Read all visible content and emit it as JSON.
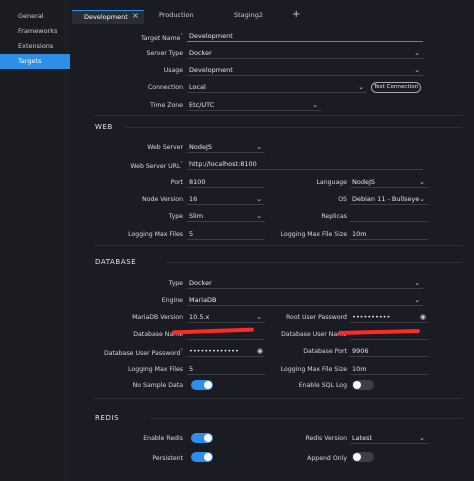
{
  "sidebar": {
    "items": [
      {
        "label": "General",
        "active": false
      },
      {
        "label": "Frameworks",
        "active": false
      },
      {
        "label": "Extensions",
        "active": false
      },
      {
        "label": "Targets",
        "active": true
      }
    ]
  },
  "tabs": [
    {
      "label": "Development",
      "active": true
    },
    {
      "label": "Production",
      "active": false
    },
    {
      "label": "Staging2",
      "active": false
    }
  ],
  "tab_close_glyph": "×",
  "tab_add_glyph": "+",
  "target": {
    "name_label": "Target Name",
    "name_value": "Development",
    "server_type_label": "Server Type",
    "server_type_value": "Docker",
    "usage_label": "Usage",
    "usage_value": "Development",
    "connection_label": "Connection",
    "connection_value": "Local",
    "test_connection_label": "Test Connection",
    "timezone_label": "Time Zone",
    "timezone_value": "Etc/UTC"
  },
  "web": {
    "heading": "WEB",
    "server_label": "Web Server",
    "server_value": "NodeJS",
    "url_label": "Web Server URL",
    "url_value": "http://localhost:8100",
    "port_label": "Port",
    "port_value": "8100",
    "language_label": "Language",
    "language_value": "NodeJS",
    "node_version_label": "Node Version",
    "node_version_value": "16",
    "os_label": "OS",
    "os_value": "Debian 11 - Bullseye",
    "type_label": "Type",
    "type_value": "Slim",
    "replicas_label": "Replicas",
    "log_max_files_label": "Logging Max Files",
    "log_max_files_value": "5",
    "log_max_size_label": "Logging Max File Size",
    "log_max_size_value": "10m"
  },
  "database": {
    "heading": "DATABASE",
    "type_label": "Type",
    "type_value": "Docker",
    "engine_label": "Engine",
    "engine_value": "MariaDB",
    "version_label": "MariaDB Version",
    "version_value": "10.5.x",
    "root_pw_label": "Root User Password",
    "root_pw_value": "••••••••••",
    "db_name_label": "Database Name",
    "db_user_name_label": "Database User Name",
    "db_user_pw_label": "Database User Password",
    "db_user_pw_value": "•••••••••••••",
    "port_label": "Database Port",
    "port_value": "9906",
    "log_max_files_label": "Logging Max Files",
    "log_max_files_value": "5",
    "log_max_size_label": "Logging Max File Size",
    "log_max_size_value": "10m",
    "no_sample_label": "No Sample Data",
    "no_sample_on": true,
    "sql_log_label": "Enable SQL Log",
    "sql_log_on": false
  },
  "redis": {
    "heading": "REDIS",
    "enable_label": "Enable Redis",
    "enable_on": true,
    "version_label": "Redis Version",
    "version_value": "Latest",
    "persistent_label": "Persistent",
    "persistent_on": true,
    "append_only_label": "Append Only",
    "append_only_on": false
  },
  "icons": {
    "chevron": "⌄",
    "eye": "◉"
  },
  "colors": {
    "accent": "#2f8fe6",
    "background": "#1b1c23",
    "sidebar": "#1b1d23",
    "required": "#e5484d",
    "redaction": "#ff2a2a"
  }
}
